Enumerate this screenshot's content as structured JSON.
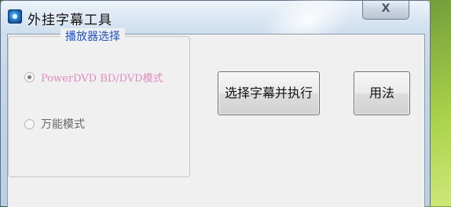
{
  "window": {
    "title": "外挂字幕工具",
    "close_label": "X"
  },
  "player_group": {
    "legend": "播放器选择",
    "options": [
      {
        "label": "PowerDVD BD/DVD模式",
        "selected": true
      },
      {
        "label": "万能模式",
        "selected": false
      }
    ]
  },
  "buttons": {
    "select_execute": "选择字幕并执行",
    "help": "用法"
  }
}
